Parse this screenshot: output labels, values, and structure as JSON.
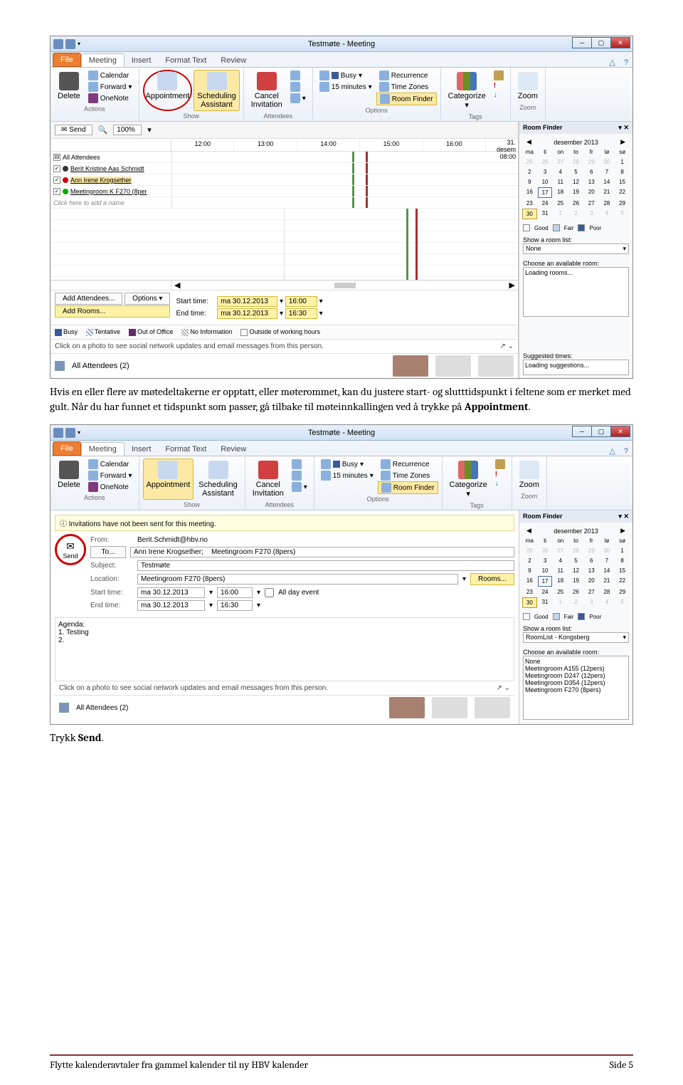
{
  "window_title": "Testmøte - Meeting",
  "ribbon": {
    "tabs": [
      "File",
      "Meeting",
      "Insert",
      "Format Text",
      "Review"
    ],
    "active_tab": "Meeting",
    "delete": "Delete",
    "calendar": "Calendar",
    "forward": "Forward",
    "onenote": "OneNote",
    "appointment": "Appointment",
    "scheduling": "Scheduling\nAssistant",
    "cancel": "Cancel\nInvitation",
    "busy": "Busy",
    "minutes": "15 minutes",
    "recurrence": "Recurrence",
    "timezones": "Time Zones",
    "roomfinder": "Room Finder",
    "categorize": "Categorize",
    "zoom": "Zoom",
    "groups": {
      "actions": "Actions",
      "show": "Show",
      "attendees": "Attendees",
      "options": "Options",
      "tags": "Tags",
      "zoom": "Zoom"
    }
  },
  "toolbar": {
    "send": "Send",
    "zoom": "100%"
  },
  "schedule": {
    "date_right": "31. desem",
    "times": [
      "12:00",
      "13:00",
      "14:00",
      "15:00",
      "16:00",
      "08:00"
    ],
    "header_all": "All Attendees",
    "att1": "Berit Kristine Aas Schmidt",
    "att2": "Ann Irene Krogsether",
    "att3": "Meetingroom K F270 (8per",
    "add_name": "Click here to add a name"
  },
  "bottom": {
    "add_attendees": "Add Attendees...",
    "options": "Options",
    "add_rooms": "Add Rooms...",
    "start_label": "Start time:",
    "end_label": "End time:",
    "start_date": "ma 30.12.2013",
    "end_date": "ma 30.12.2013",
    "start_time": "16:00",
    "end_time": "16:30"
  },
  "legend": {
    "busy": "Busy",
    "tentative": "Tentative",
    "oof": "Out of Office",
    "noinfo": "No Information",
    "outside": "Outside of working hours"
  },
  "social": "Click on a photo to see social network updates and email messages from this person.",
  "people": "All Attendees (2)",
  "roomfinder": {
    "title": "Room Finder",
    "month": "desember 2013",
    "days": [
      "ma",
      "ti",
      "on",
      "to",
      "fr",
      "lø",
      "sø"
    ],
    "prev_days": [
      "25",
      "26",
      "27",
      "28",
      "29",
      "30"
    ],
    "cur_days": [
      "1",
      "2",
      "3",
      "4",
      "5",
      "6",
      "7",
      "8",
      "9",
      "10",
      "11",
      "12",
      "13",
      "14",
      "15",
      "16",
      "17",
      "18",
      "19",
      "20",
      "21",
      "22",
      "23",
      "24",
      "25",
      "26",
      "27",
      "28",
      "29",
      "30",
      "31"
    ],
    "next_days": [
      "1",
      "2",
      "3",
      "4",
      "5"
    ],
    "selected_a": "17",
    "selected_b": "30",
    "good": "Good",
    "fair": "Fair",
    "poor": "Poor",
    "show_room": "Show a room list:",
    "none": "None",
    "choose": "Choose an available room:",
    "loading_rooms": "Loading rooms...",
    "suggested": "Suggested times:",
    "loading_sugg": "Loading suggestions...",
    "roomlist": "RoomList - Kongsberg",
    "rooms_b": [
      "None",
      "Meetingroom A155 (12pers)",
      "Meetingroom D247 (12pers)",
      "Meetingroom D354 (12pers)",
      "Meetingroom F270 (8pers)"
    ]
  },
  "para1": "Hvis en eller flere av møtedeltakerne er opptatt, eller møterommet, kan du justere start- og slutttidspunkt i feltene som er merket med gult. Når du har funnet et tidspunkt som passer, gå tilbake til møteinnkallingen ved å trykke på ",
  "para1_bold": "Appointment",
  "para1_end": ".",
  "form": {
    "info": "Invitations have not been sent for this meeting.",
    "send": "Send",
    "from_lbl": "From:",
    "from": "Berit.Schmidt@hbv.no",
    "to_lbl": "To...",
    "to": "Ann Irene Krogsether;    Meetingroom F270 (8pers)",
    "subject_lbl": "Subject:",
    "subject": "Testmøte",
    "location_lbl": "Location:",
    "location": "Meetingroom F270 (8pers)",
    "rooms": "Rooms...",
    "start_lbl": "Start time:",
    "start_d": "ma 30.12.2013",
    "start_t": "16:00",
    "end_lbl": "End time:",
    "end_d": "ma 30.12.2013",
    "end_t": "16:30",
    "allday": "All day event",
    "agenda_lbl": "Agenda:",
    "agenda1": "1.   Testing",
    "agenda2": "2."
  },
  "para2_a": "Trykk ",
  "para2_b": "Send",
  "para2_c": ".",
  "footer": {
    "left": "Flytte kalenderavtaler fra gammel kalender til ny HBV kalender",
    "right": "Side 5"
  }
}
